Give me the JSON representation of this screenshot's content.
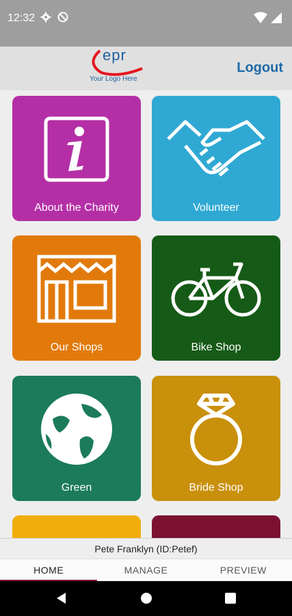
{
  "status_bar": {
    "time": "12:32",
    "icons": [
      "gear-icon",
      "no-disturb-icon",
      "wifi-icon",
      "battery-icon"
    ]
  },
  "header": {
    "logo_text": "epr",
    "logo_subtitle": "Your Logo Here",
    "logout_label": "Logout"
  },
  "tiles": [
    {
      "label": "About the Charity",
      "color": "#b42fa6",
      "icon": "info-icon"
    },
    {
      "label": "Volunteer",
      "color": "#2fa9d3",
      "icon": "handshake-icon"
    },
    {
      "label": "Our Shops",
      "color": "#e27a0b",
      "icon": "storefront-icon"
    },
    {
      "label": "Bike Shop",
      "color": "#165a17",
      "icon": "bicycle-icon"
    },
    {
      "label": "Green",
      "color": "#1c7b5a",
      "icon": "globe-icon"
    },
    {
      "label": "Bride Shop",
      "color": "#c9900c",
      "icon": "ring-icon"
    },
    {
      "label": "",
      "color": "#f0ad0c",
      "icon": ""
    },
    {
      "label": "",
      "color": "#7b1232",
      "icon": ""
    }
  ],
  "user_bar": {
    "text": "Pete Franklyn (ID:Petef)"
  },
  "tabs": [
    {
      "label": "HOME",
      "active": true
    },
    {
      "label": "MANAGE",
      "active": false
    },
    {
      "label": "PREVIEW",
      "active": false
    }
  ],
  "colors": {
    "accent": "#8b1538",
    "header_link": "#1f6aa8"
  },
  "nav_buttons": [
    "back-icon",
    "home-icon",
    "recents-icon"
  ]
}
